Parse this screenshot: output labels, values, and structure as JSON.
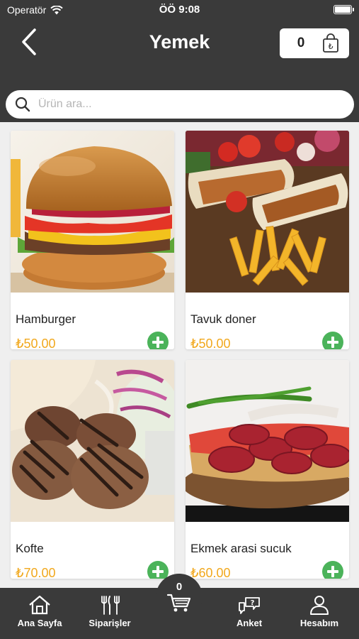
{
  "status_bar": {
    "carrier": "Operatör",
    "time": "ÖÖ 9:08"
  },
  "header": {
    "title": "Yemek",
    "cart_count": "0"
  },
  "search": {
    "placeholder": "Ürün ara..."
  },
  "products": [
    {
      "name": "Hamburger",
      "price": "₺50.00",
      "image": "hamburger"
    },
    {
      "name": "Tavuk doner",
      "price": "₺50.00",
      "image": "chicken-doner-wrap-with-fries"
    },
    {
      "name": "Kofte",
      "price": "₺70.00",
      "image": "grilled-meatballs-with-salad"
    },
    {
      "name": "Ekmek arasi sucuk",
      "price": "₺60.00",
      "image": "sausage-sandwich-with-peppers"
    }
  ],
  "tabbar": {
    "cart_count": "0",
    "items": [
      {
        "label": "Ana Sayfa",
        "icon": "home-icon"
      },
      {
        "label": "Siparişler",
        "icon": "fork-knife-icon"
      },
      {
        "label": "Anket",
        "icon": "chat-question-icon"
      },
      {
        "label": "Hesabım",
        "icon": "person-icon"
      }
    ]
  },
  "colors": {
    "header_bg": "#3a3a3a",
    "page_bg": "#efefef",
    "price": "#f1a81d",
    "add_button": "#4bb35a"
  }
}
